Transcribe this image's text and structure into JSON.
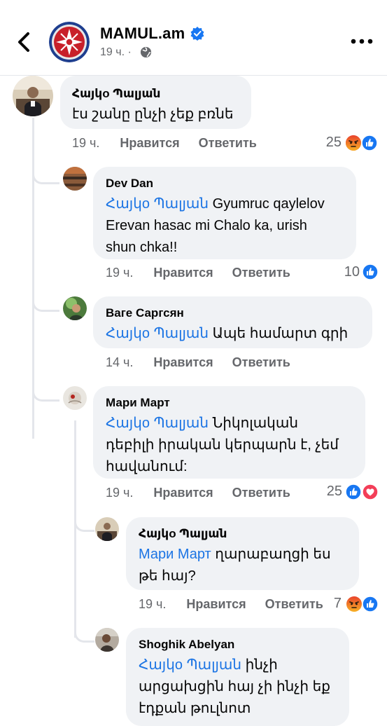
{
  "header": {
    "page_name": "MAMUL.am",
    "post_time": "19 ч. ·"
  },
  "actions": {
    "like": "Нравится",
    "reply": "Ответить"
  },
  "comments": [
    {
      "author": "Հայկo Պալյան",
      "text": "էս շանը ընչի չեք բռնե",
      "time": "19 ч.",
      "reaction_count": "25",
      "reactions": [
        "angry",
        "like"
      ]
    },
    {
      "author": "Dev Dan",
      "mention": "Հայկo Պալյան",
      "text": " Gyumruc qaylelov\nErevan hasac mi Chalo ka, urish\nshun chka!!",
      "time": "19 ч.",
      "reaction_count": "10",
      "reactions": [
        "like"
      ]
    },
    {
      "author": "Ваге Саргсян",
      "mention": "Հայկo Պալյան",
      "text": " Ապե համարտ գրի",
      "time": "14 ч.",
      "reaction_count": "",
      "reactions": []
    },
    {
      "author": "Мари Март",
      "mention": "Հայկo Պալյան",
      "text": "  Նիկոլական\nդեբիլի  իրական կերպարն է, չեմ\nհավանում:",
      "time": "19 ч.",
      "reaction_count": "25",
      "reactions": [
        "like",
        "love"
      ]
    },
    {
      "author": "Հայկo Պալյան",
      "mention": "Мари Март",
      "text": " ղարաբաղցի ես\nթե հայ?",
      "time": "19 ч.",
      "reaction_count": "7",
      "reactions": [
        "angry",
        "like"
      ]
    },
    {
      "author": "Shoghik Abelyan",
      "mention": "Հայկo Պալյան",
      "text": " ինչի\nարցախցին հայ չի ինչի եք\nէդքան թուլնոտ",
      "time": "",
      "reaction_count": "",
      "reactions": []
    }
  ]
}
